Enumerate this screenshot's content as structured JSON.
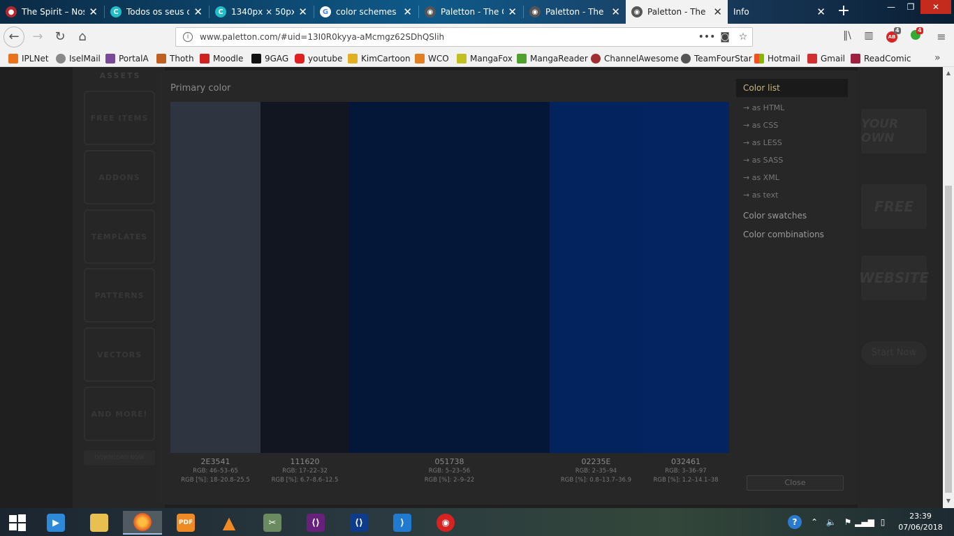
{
  "browser": {
    "tabs": [
      {
        "title": "The Spirit – Nos",
        "icon": "spirit-icon",
        "color": "#b3272d"
      },
      {
        "title": "Todos os seus d",
        "icon": "canva-icon",
        "color": "#1fbec9"
      },
      {
        "title": "1340px × 50px –",
        "icon": "canva-icon",
        "color": "#1fbec9"
      },
      {
        "title": "color schemes",
        "icon": "google-icon",
        "color": "#4285f4"
      },
      {
        "title": "Paletton - The C",
        "icon": "paletton-icon",
        "color": "#555555"
      },
      {
        "title": "Paletton - The C",
        "icon": "paletton-icon",
        "color": "#555555"
      },
      {
        "title": "Paletton - The C",
        "icon": "paletton-icon",
        "color": "#555555"
      },
      {
        "title": "Info",
        "icon": "",
        "color": ""
      }
    ],
    "url": "www.paletton.com/#uid=13I0R0kyya-aMcmgz62SDhQSlih",
    "addon_badges": [
      "4",
      "4"
    ]
  },
  "bookmarks": [
    {
      "label": "IPLNet",
      "color": "#e8731a"
    },
    {
      "label": "IselMail",
      "color": "#888888"
    },
    {
      "label": "PortalA",
      "color": "#7a4a9a"
    },
    {
      "label": "Thoth",
      "color": "#c06020"
    },
    {
      "label": "Moodle",
      "color": "#d02020"
    },
    {
      "label": "9GAG",
      "color": "#111111"
    },
    {
      "label": "youtube",
      "color": "#e02020"
    },
    {
      "label": "KimCartoon",
      "color": "#e0b020"
    },
    {
      "label": "WCO",
      "color": "#e08020"
    },
    {
      "label": "MangaFox",
      "color": "#c0c020"
    },
    {
      "label": "MangaReader",
      "color": "#50a030"
    },
    {
      "label": "ChannelAwesome",
      "color": "#a03030"
    },
    {
      "label": "TeamFourStar",
      "color": "#555555"
    },
    {
      "label": "Hotmail",
      "color": "#2a7ad0"
    },
    {
      "label": "Gmail",
      "color": "#d03030"
    },
    {
      "label": "ReadComic",
      "color": "#a02040"
    }
  ],
  "site": {
    "left_sidebar": {
      "heading": "ASSETS",
      "tiles": [
        "FREE ITEMS",
        "ADDONS",
        "TEMPLATES",
        "PATTERNS",
        "VECTORS",
        "AND MORE!"
      ],
      "button": "DOWNLOAD NOW"
    },
    "right_sidebar": {
      "signs": [
        "YOUR OWN",
        "FREE",
        "WEBSITE"
      ],
      "start": "Start Now"
    }
  },
  "modal": {
    "title": "Primary color",
    "swatches": [
      {
        "hex": "2E3541",
        "rgb": "RGB: 46–53–65",
        "rgb_pct": "RGB [%]: 18–20.8–25.5",
        "color": "#2E3541"
      },
      {
        "hex": "111620",
        "rgb": "RGB: 17–22–32",
        "rgb_pct": "RGB [%]: 6.7–8.6–12.5",
        "color": "#111620"
      },
      {
        "hex": "051738",
        "rgb": "RGB: 5–23–56",
        "rgb_pct": "RGB [%]: 2–9–22",
        "color": "#051738"
      },
      {
        "hex": "02235E",
        "rgb": "RGB: 2–35–94",
        "rgb_pct": "RGB [%]: 0.8–13.7–36.9",
        "color": "#02235E"
      },
      {
        "hex": "032461",
        "rgb": "RGB: 3–36–97",
        "rgb_pct": "RGB [%]: 1.2–14.1–38",
        "color": "#032461"
      }
    ],
    "menu": {
      "heading": "Color list",
      "subitems": [
        "→ as HTML",
        "→ as CSS",
        "→ as LESS",
        "→ as SASS",
        "→ as XML",
        "→ as text"
      ],
      "items": [
        "Color swatches",
        "Color combinations"
      ]
    },
    "close_label": "Close"
  },
  "taskbar": {
    "time": "23:39",
    "date": "07/06/2018"
  }
}
